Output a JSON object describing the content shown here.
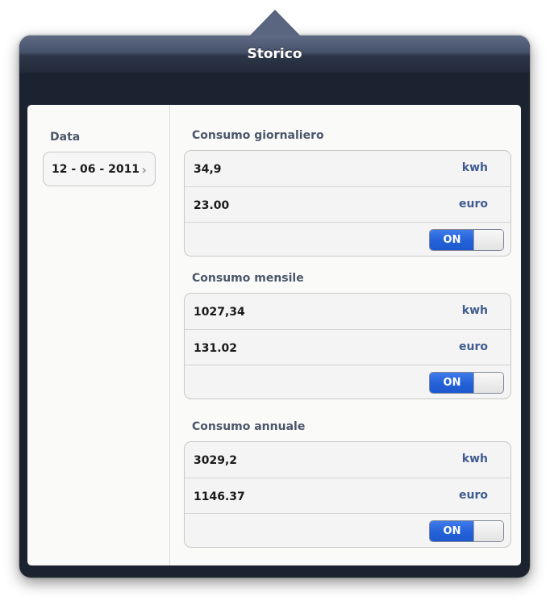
{
  "header": {
    "title": "Storico"
  },
  "left": {
    "date_label": "Data",
    "date_value": "12 - 06 - 2011",
    "chevron_icon": "chevron-right-icon"
  },
  "sections": [
    {
      "title": "Consumo giornaliero",
      "energy_value": "34,9",
      "energy_unit": "kwh",
      "cost_value": "23.00",
      "cost_unit": "euro",
      "toggle_label": "ON",
      "toggle_state": true
    },
    {
      "title": "Consumo mensile",
      "energy_value": "1027,34",
      "energy_unit": "kwh",
      "cost_value": "131.02",
      "cost_unit": "euro",
      "toggle_label": "ON",
      "toggle_state": true
    },
    {
      "title": "Consumo annuale",
      "energy_value": "3029,2",
      "energy_unit": "kwh",
      "cost_value": "1146.37",
      "cost_unit": "euro",
      "toggle_label": "ON",
      "toggle_state": true
    }
  ],
  "colors": {
    "title_bar": "#46516a",
    "accent_blue": "#2563d8",
    "unit_text": "#3f5b8f",
    "section_title": "#4c566a"
  }
}
